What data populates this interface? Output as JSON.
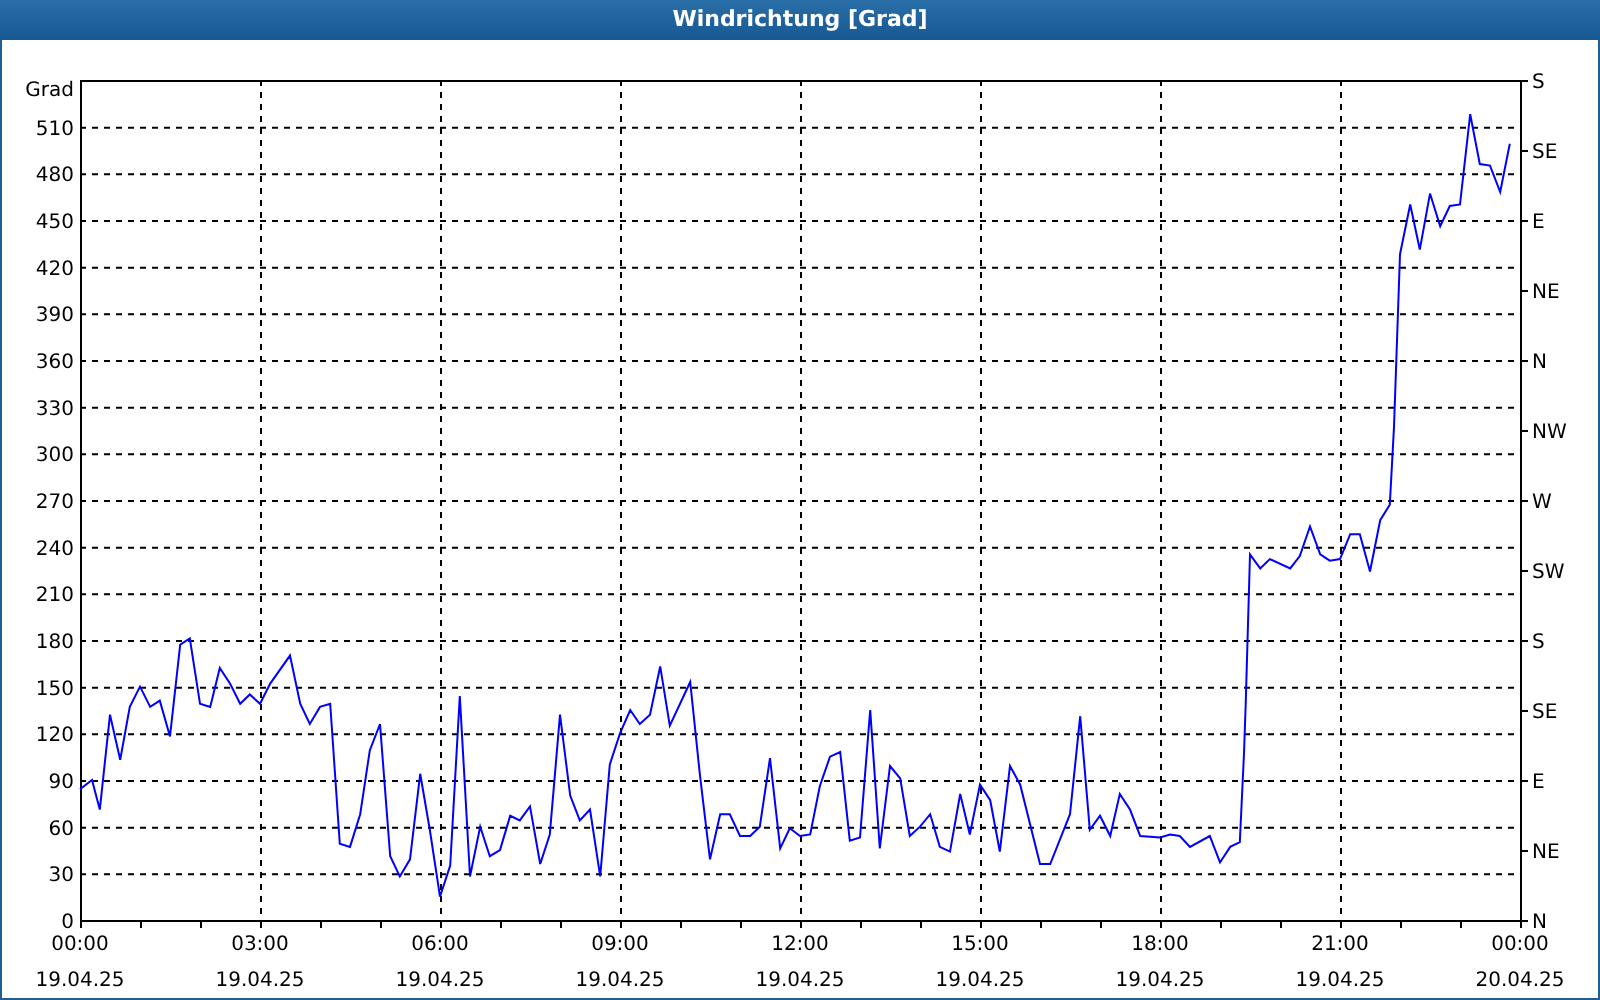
{
  "window": {
    "title": "Windrichtung [Grad]"
  },
  "chart": {
    "chart_data": {
      "type": "line",
      "ylabel": "Grad",
      "xlim": [
        0,
        24
      ],
      "ylim": [
        0,
        540
      ],
      "yticks": [
        0,
        30,
        60,
        90,
        120,
        150,
        180,
        210,
        240,
        270,
        300,
        330,
        360,
        390,
        420,
        450,
        480,
        510
      ],
      "xticks": [
        {
          "value": 0,
          "label": "00:00"
        },
        {
          "value": 3,
          "label": "03:00"
        },
        {
          "value": 6,
          "label": "06:00"
        },
        {
          "value": 9,
          "label": "09:00"
        },
        {
          "value": 12,
          "label": "12:00"
        },
        {
          "value": 15,
          "label": "15:00"
        },
        {
          "value": 18,
          "label": "18:00"
        },
        {
          "value": 21,
          "label": "21:00"
        },
        {
          "value": 24,
          "label": "00:00"
        }
      ],
      "x": [
        0,
        0.2,
        0.33,
        0.5,
        0.67,
        0.83,
        1,
        1.17,
        1.33,
        1.5,
        1.67,
        1.83,
        2,
        2.17,
        2.33,
        2.5,
        2.67,
        2.83,
        3,
        3.17,
        3.5,
        3.67,
        3.83,
        4,
        4.17,
        4.33,
        4.5,
        4.67,
        4.83,
        5,
        5.17,
        5.33,
        5.5,
        5.67,
        5.83,
        6,
        6.17,
        6.33,
        6.5,
        6.67,
        6.83,
        7,
        7.17,
        7.33,
        7.5,
        7.67,
        7.83,
        8,
        8.17,
        8.33,
        8.5,
        8.67,
        8.83,
        9,
        9.17,
        9.33,
        9.5,
        9.67,
        9.83,
        10.17,
        10.33,
        10.5,
        10.67,
        10.83,
        11,
        11.17,
        11.33,
        11.5,
        11.67,
        11.83,
        12,
        12.17,
        12.33,
        12.5,
        12.67,
        12.83,
        13,
        13.17,
        13.33,
        13.5,
        13.67,
        13.83,
        14,
        14.17,
        14.33,
        14.5,
        14.67,
        14.83,
        15,
        15.17,
        15.33,
        15.5,
        15.67,
        16,
        16.17,
        16.5,
        16.67,
        16.83,
        17,
        17.17,
        17.33,
        17.5,
        17.67,
        18,
        18.17,
        18.33,
        18.5,
        18.83,
        19,
        19.17,
        19.33,
        19.4,
        19.43,
        19.5,
        19.67,
        19.83,
        20.17,
        20.33,
        20.5,
        20.67,
        20.83,
        21,
        21.17,
        21.33,
        21.5,
        21.67,
        21.83,
        21.9,
        22,
        22.17,
        22.33,
        22.5,
        22.67,
        22.83,
        23,
        23.17,
        23.33,
        23.5,
        23.67,
        23.83
      ],
      "grid": true,
      "series": [
        {
          "color": "#0000ff",
          "values": [
            84,
            90,
            71,
            132,
            103,
            137,
            150,
            137,
            141,
            118,
            177,
            181,
            139,
            137,
            162,
            152,
            139,
            145,
            139,
            152,
            170,
            139,
            126,
            137,
            139,
            49,
            47,
            68,
            109,
            126,
            41,
            28,
            39,
            94,
            58,
            15,
            35,
            144,
            28,
            60,
            41,
            45,
            67,
            64,
            73,
            36,
            55,
            132,
            80,
            64,
            71,
            28,
            100,
            120,
            135,
            126,
            132,
            163,
            125,
            153,
            94,
            39,
            68,
            68,
            54,
            54,
            60,
            104,
            46,
            59,
            54,
            55,
            86,
            105,
            108,
            51,
            53,
            135,
            46,
            99,
            91,
            54,
            60,
            68,
            47,
            44,
            81,
            55,
            87,
            77,
            44,
            99,
            87,
            36,
            36,
            68,
            131,
            58,
            67,
            54,
            81,
            71,
            54,
            53,
            55,
            54,
            47,
            54,
            37,
            47,
            50,
            107,
            141,
            235,
            226,
            232,
            226,
            234,
            253,
            235,
            231,
            232,
            248,
            248,
            224,
            257,
            267,
            317,
            428,
            460,
            431,
            467,
            446,
            459,
            460,
            518,
            486,
            485,
            468,
            499
          ]
        }
      ]
    },
    "tick_dates": [
      "19.04.25",
      "19.04.25",
      "19.04.25",
      "19.04.25",
      "19.04.25",
      "19.04.25",
      "19.04.25",
      "19.04.25",
      "20.04.25"
    ],
    "compass_labels": [
      "S",
      "SE",
      "E",
      "NE",
      "N",
      "NW",
      "W",
      "SW",
      "S",
      "SE",
      "E",
      "NE",
      "N"
    ]
  }
}
